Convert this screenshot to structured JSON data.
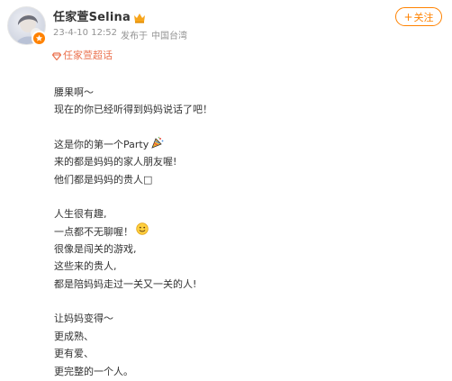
{
  "header": {
    "username": "任家萱Selina",
    "timestamp": "23-4-10 12:52",
    "posted_label": "发布于",
    "location": "中国台湾",
    "follow_label": "关注",
    "follow_plus": "+",
    "supertopic_label": "任家萱超话"
  },
  "post": {
    "lines": [
      "腰果啊～",
      "现在的你已经听得到妈妈说话了吧！",
      "",
      "这是你的第一个Party",
      "来的都是妈妈的家人朋友喔!",
      "他们都是妈妈的贵人□",
      "",
      "人生很有趣,",
      "一点都不无聊喔！",
      "很像是闯关的游戏,",
      "这些来的贵人,",
      "都是陪妈妈走过一关又一关的人!",
      "",
      "让妈妈变得～",
      "更成熟、",
      "更有爱、",
      "更完整的一个人。"
    ]
  },
  "icons": {
    "avatar": "avatar-image",
    "verified": "verified-badge-icon",
    "crown": "crown-icon",
    "diamond": "diamond-icon",
    "party": "party-popper-icon",
    "smile": "smile-emoji-icon"
  },
  "colors": {
    "accent": "#ff8200",
    "link": "#eb7350",
    "text": "#333333",
    "meta": "#939393"
  }
}
